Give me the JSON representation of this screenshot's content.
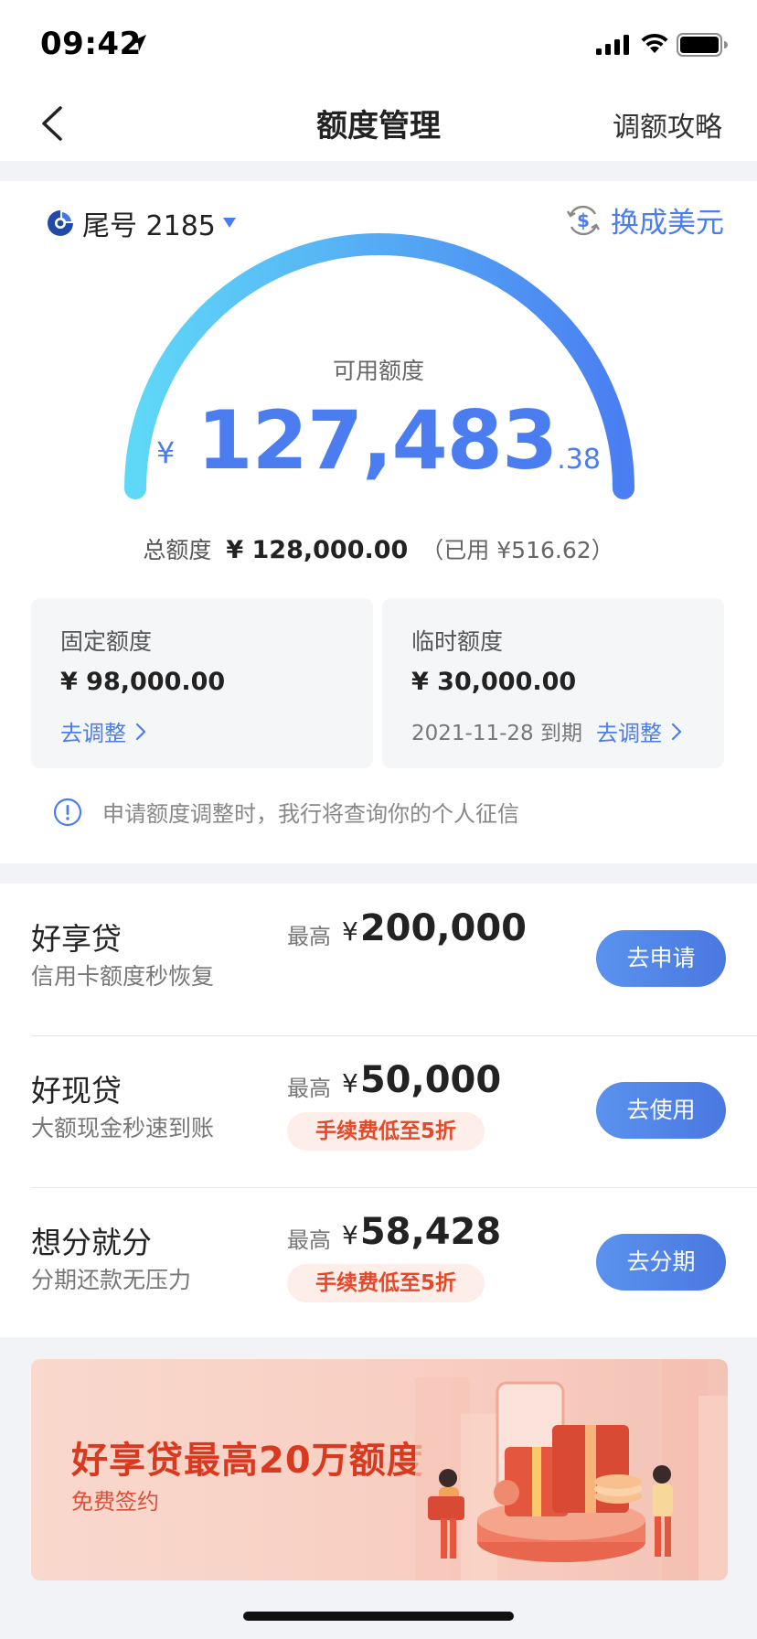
{
  "status_bar": {
    "time": "09:42"
  },
  "nav": {
    "title": "额度管理",
    "action": "调额攻略"
  },
  "card": {
    "tail": "尾号 2185",
    "currency_switch": "换成美元"
  },
  "available": {
    "label": "可用额度",
    "currency": "¥",
    "integer": "127,483",
    "decimal": ".38"
  },
  "total": {
    "label": "总额度",
    "value": "¥ 128,000.00",
    "used": "（已用 ¥516.62）"
  },
  "fixed_quota": {
    "label": "固定额度",
    "value": "¥ 98,000.00",
    "adjust": "去调整"
  },
  "temp_quota": {
    "label": "临时额度",
    "value": "¥ 30,000.00",
    "expiry": "2021-11-28 到期",
    "adjust": "去调整"
  },
  "notice": "申请额度调整时，我行将查询你的个人征信",
  "products": [
    {
      "name": "好享贷",
      "desc": "信用卡额度秒恢复",
      "max_label": "最高",
      "currency": "¥",
      "amount": "200,000",
      "fee": "",
      "button": "去申请"
    },
    {
      "name": "好现贷",
      "desc": "大额现金秒速到账",
      "max_label": "最高",
      "currency": "¥",
      "amount": "50,000",
      "fee": "手续费低至5折",
      "button": "去使用"
    },
    {
      "name": "想分就分",
      "desc": "分期还款无压力",
      "max_label": "最高",
      "currency": "¥",
      "amount": "58,428",
      "fee": "手续费低至5折",
      "button": "去分期"
    }
  ],
  "banner": {
    "title": "好享贷最高20万额度",
    "subtitle": "免费签约"
  },
  "colors": {
    "accent": "#4b7df0",
    "gauge_start": "#5fd8f7",
    "gauge_end": "#4a7ef2",
    "fee_red": "#e24a2b"
  }
}
